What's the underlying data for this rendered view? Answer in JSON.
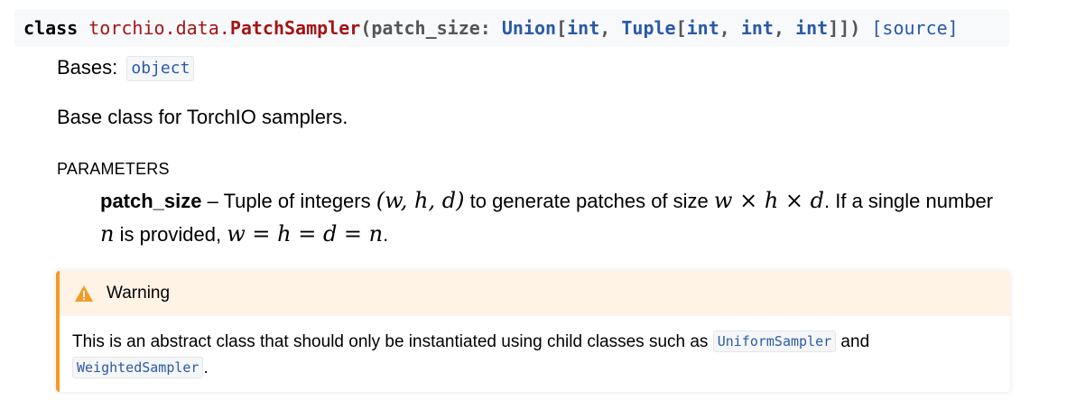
{
  "signature": {
    "keyword": "class",
    "module": "torchio.data.",
    "class_name": "PatchSampler",
    "open_paren": "(",
    "param_name": "patch_size",
    "colon": ":",
    "type_union": "Union",
    "lb1": "[",
    "type_int_1": "int",
    "comma1": ",",
    "type_tuple": "Tuple",
    "lb2": "[",
    "type_int_2": "int",
    "comma2": ",",
    "type_int_3": "int",
    "comma3": ",",
    "type_int_4": "int",
    "close": "]])",
    "source_link": "[source]"
  },
  "bases": {
    "label": "Bases:",
    "value": "object"
  },
  "description": "Base class for TorchIO samplers.",
  "parameters": {
    "heading": "PARAMETERS",
    "items": [
      {
        "name": "patch_size",
        "text_1": " – Tuple of integers ",
        "math_1": "(w, h, d)",
        "text_2": " to generate patches of size ",
        "math_2": "w × h × d",
        "text_3": ". If a single number ",
        "math_3": "n",
        "text_4": " is provided, ",
        "math_4": "w = h = d = n",
        "text_5": "."
      }
    ]
  },
  "warning": {
    "title": "Warning",
    "text_1": "This is an abstract class that should only be instantiated using child classes such as ",
    "code_1": "UniformSampler",
    "text_2": " and ",
    "code_2": "WeightedSampler",
    "text_3": ".",
    "accent_color": "#f59a23",
    "icon": "warning-triangle-icon"
  }
}
